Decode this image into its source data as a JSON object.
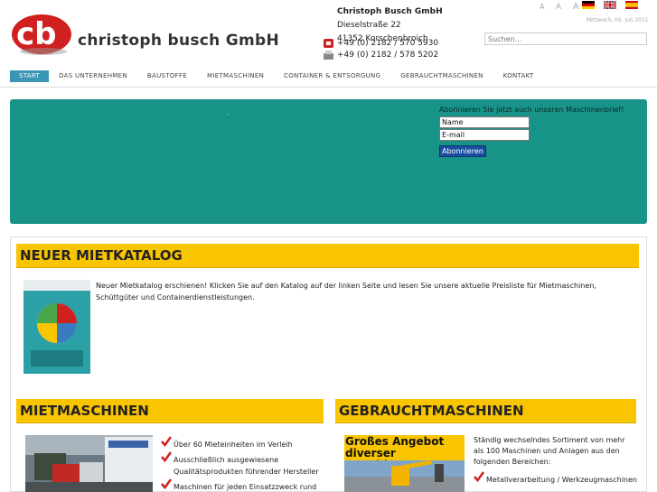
{
  "header": {
    "brand": "christoph busch GmbH",
    "company": "Christoph Busch GmbH",
    "street": "Dieselstraße 22",
    "city": "41352 Korschenbroich",
    "phone": "+49 (0) 2182 / 570 5930",
    "fax": "+49 (0) 2182 / 578 5202",
    "font_sizes": [
      "A",
      "A",
      "A"
    ],
    "date": "Mittwoch, 06. Juli 2011",
    "search_placeholder": "Suchen..."
  },
  "nav": {
    "items": [
      "START",
      "DAS UNTERNEHMEN",
      "BAUSTOFFE",
      "MIETMASCHINEN",
      "CONTAINER & ENTSORGUNG",
      "GEBRAUCHTMASCHINEN",
      "KONTAKT"
    ],
    "active": 0
  },
  "banner": {
    "dot": ".",
    "newsletter_title": "Abonnieren Sie jetzt auch unseren Maschinenbrief!",
    "name_value": "Name",
    "email_value": "E-mail",
    "subscribe_label": "Abonnieren"
  },
  "catalog": {
    "heading": "NEUER MIETKATALOG",
    "text": "Neuer Mietkatalog erschienen! Klicken Sie auf den Katalog auf der linken Seite und lesen Sie unsere aktuelle Preisliste für Mietmaschinen, Schüttgüter und Containerdienstleistungen."
  },
  "rental": {
    "heading": "MIETMASCHINEN",
    "points": [
      "Über 60 Mieteinheiten im Verleih",
      "Ausschließlich ausgewiesene Qualitätsprodukten führender Hersteller",
      "Maschinen für jeden Einsatzzweck rund um"
    ]
  },
  "used": {
    "heading": "GEBRAUCHTMASCHINEN",
    "photo_title": "Großes Angebot diverser Maschinen",
    "text": "Ständig wechselndes Sortiment von mehr als 100 Maschinen und Anlagen aus den folgenden Bereichen:",
    "points": [
      "Metallverarbeitung / Werkzeugmaschinen"
    ]
  },
  "colors": {
    "accent": "#3a96b4",
    "banner": "#189388",
    "heading_bar": "#f9c400",
    "logo_red": "#d0201f"
  }
}
